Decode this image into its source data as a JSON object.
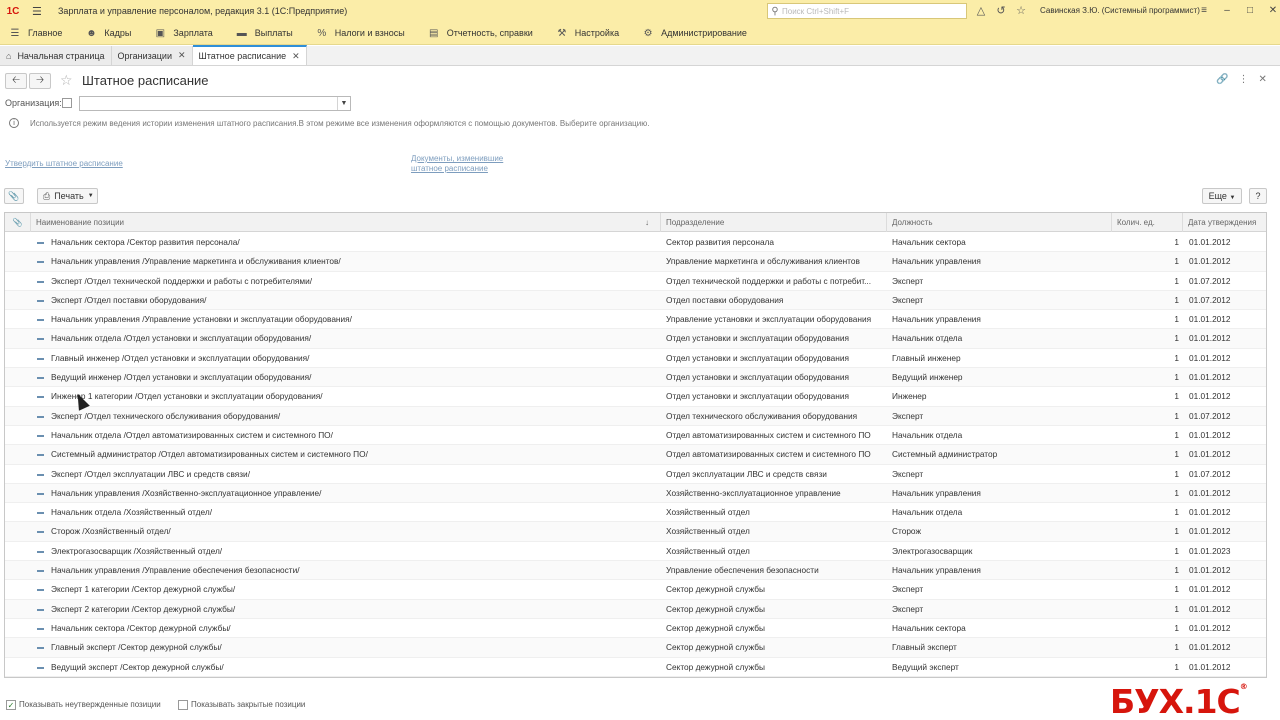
{
  "titlebar": {
    "logo": "1С",
    "title": "Зарплата и управление персоналом, редакция 3.1  (1С:Предприятие)",
    "search_placeholder": "Поиск Ctrl+Shift+F",
    "user": "Савинская З.Ю. (Системный программист)"
  },
  "sections": [
    {
      "label": "Главное",
      "icon": "menu-icon"
    },
    {
      "label": "Кадры",
      "icon": "people-icon"
    },
    {
      "label": "Зарплата",
      "icon": "wallet-icon"
    },
    {
      "label": "Выплаты",
      "icon": "card-icon"
    },
    {
      "label": "Налоги и взносы",
      "icon": "percent-icon"
    },
    {
      "label": "Отчетность, справки",
      "icon": "report-icon"
    },
    {
      "label": "Настройка",
      "icon": "wrench-icon"
    },
    {
      "label": "Администрирование",
      "icon": "gear-icon"
    }
  ],
  "tabs": [
    {
      "label": "Начальная страница",
      "closable": false
    },
    {
      "label": "Организации",
      "closable": true
    },
    {
      "label": "Штатное расписание",
      "closable": true
    }
  ],
  "form": {
    "title": "Штатное расписание",
    "org_label": "Организация:",
    "org_value": "",
    "info": "Используется режим ведения истории изменения штатного расписания.В этом режиме все изменения оформляются с помощью документов. Выберите организацию.",
    "link_approve": "Утвердить штатное расписание",
    "link_docs_line1": "Документы, изменившие",
    "link_docs_line2": "штатное расписание",
    "print_label": "Печать",
    "more_label": "Еще",
    "help_label": "?"
  },
  "table": {
    "columns": [
      "Наименование позиции",
      "Подразделение",
      "Должность",
      "Колич. ед.",
      "Дата утверждения"
    ],
    "rows": [
      {
        "name": "Начальник сектора /Сектор развития персонала/",
        "division": "Сектор развития персонала",
        "position": "Начальник сектора",
        "qty": "1",
        "date": "01.01.2012"
      },
      {
        "name": "Начальник управления /Управление маркетинга и обслуживания клиентов/",
        "division": "Управление маркетинга и обслуживания клиентов",
        "position": "Начальник управления",
        "qty": "1",
        "date": "01.01.2012"
      },
      {
        "name": "Эксперт /Отдел технической поддержки и работы с потребителями/",
        "division": "Отдел технической поддержки и работы с потребит...",
        "position": "Эксперт",
        "qty": "1",
        "date": "01.07.2012"
      },
      {
        "name": "Эксперт /Отдел поставки оборудования/",
        "division": "Отдел поставки оборудования",
        "position": "Эксперт",
        "qty": "1",
        "date": "01.07.2012"
      },
      {
        "name": "Начальник управления /Управление установки и эксплуатации оборудования/",
        "division": "Управление установки и эксплуатации оборудования",
        "position": "Начальник управления",
        "qty": "1",
        "date": "01.01.2012"
      },
      {
        "name": "Начальник отдела /Отдел установки и эксплуатации оборудования/",
        "division": "Отдел установки и эксплуатации оборудования",
        "position": "Начальник отдела",
        "qty": "1",
        "date": "01.01.2012"
      },
      {
        "name": "Главный инженер /Отдел установки и эксплуатации оборудования/",
        "division": "Отдел установки и эксплуатации оборудования",
        "position": "Главный инженер",
        "qty": "1",
        "date": "01.01.2012"
      },
      {
        "name": "Ведущий инженер /Отдел установки и эксплуатации оборудования/",
        "division": "Отдел установки и эксплуатации оборудования",
        "position": "Ведущий инженер",
        "qty": "1",
        "date": "01.01.2012"
      },
      {
        "name": "Инженер 1 категории /Отдел установки и эксплуатации оборудования/",
        "division": "Отдел установки и эксплуатации оборудования",
        "position": "Инженер",
        "qty": "1",
        "date": "01.01.2012"
      },
      {
        "name": "Эксперт /Отдел технического обслуживания оборудования/",
        "division": "Отдел технического обслуживания оборудования",
        "position": "Эксперт",
        "qty": "1",
        "date": "01.07.2012"
      },
      {
        "name": "Начальник отдела /Отдел автоматизированных систем и системного ПО/",
        "division": "Отдел автоматизированных систем и системного ПО",
        "position": "Начальник отдела",
        "qty": "1",
        "date": "01.01.2012"
      },
      {
        "name": "Системный администратор /Отдел автоматизированных систем и системного ПО/",
        "division": "Отдел автоматизированных систем и системного ПО",
        "position": "Системный администратор",
        "qty": "1",
        "date": "01.01.2012"
      },
      {
        "name": "Эксперт /Отдел эксплуатации ЛВС и средств связи/",
        "division": "Отдел эксплуатации ЛВС и средств связи",
        "position": "Эксперт",
        "qty": "1",
        "date": "01.07.2012"
      },
      {
        "name": "Начальник управления /Хозяйственно-эксплуатационное управление/",
        "division": "Хозяйственно-эксплуатационное управление",
        "position": "Начальник управления",
        "qty": "1",
        "date": "01.01.2012"
      },
      {
        "name": "Начальник отдела /Хозяйственный отдел/",
        "division": "Хозяйственный отдел",
        "position": "Начальник отдела",
        "qty": "1",
        "date": "01.01.2012"
      },
      {
        "name": "Сторож /Хозяйственный отдел/",
        "division": "Хозяйственный отдел",
        "position": "Сторож",
        "qty": "1",
        "date": "01.01.2012"
      },
      {
        "name": "Электрогазосварщик /Хозяйственный отдел/",
        "division": "Хозяйственный отдел",
        "position": "Электрогазосварщик",
        "qty": "1",
        "date": "01.01.2023"
      },
      {
        "name": "Начальник управления /Управление обеспечения безопасности/",
        "division": "Управление обеспечения безопасности",
        "position": "Начальник управления",
        "qty": "1",
        "date": "01.01.2012"
      },
      {
        "name": "Эксперт 1 категории /Сектор дежурной службы/",
        "division": "Сектор дежурной службы",
        "position": "Эксперт",
        "qty": "1",
        "date": "01.01.2012"
      },
      {
        "name": "Эксперт 2 категории /Сектор дежурной службы/",
        "division": "Сектор дежурной службы",
        "position": "Эксперт",
        "qty": "1",
        "date": "01.01.2012"
      },
      {
        "name": "Начальник сектора /Сектор дежурной службы/",
        "division": "Сектор дежурной службы",
        "position": "Начальник сектора",
        "qty": "1",
        "date": "01.01.2012"
      },
      {
        "name": "Главный эксперт /Сектор дежурной службы/",
        "division": "Сектор дежурной службы",
        "position": "Главный эксперт",
        "qty": "1",
        "date": "01.01.2012"
      },
      {
        "name": "Ведущий эксперт /Сектор дежурной службы/",
        "division": "Сектор дежурной службы",
        "position": "Ведущий эксперт",
        "qty": "1",
        "date": "01.01.2012"
      }
    ]
  },
  "footer": {
    "show_unapproved_label": "Показывать неутвержденные позиции",
    "show_unapproved_checked": true,
    "show_closed_label": "Показывать закрытые позиции",
    "show_closed_checked": false
  },
  "brand": {
    "text": "БУХ.1С",
    "reg": "®"
  },
  "colors": {
    "panel_bg": "#fbeda8",
    "active_tab_accent": "#2f8fd8",
    "link": "#7d9dbe",
    "brand_red": "#d6150c"
  }
}
